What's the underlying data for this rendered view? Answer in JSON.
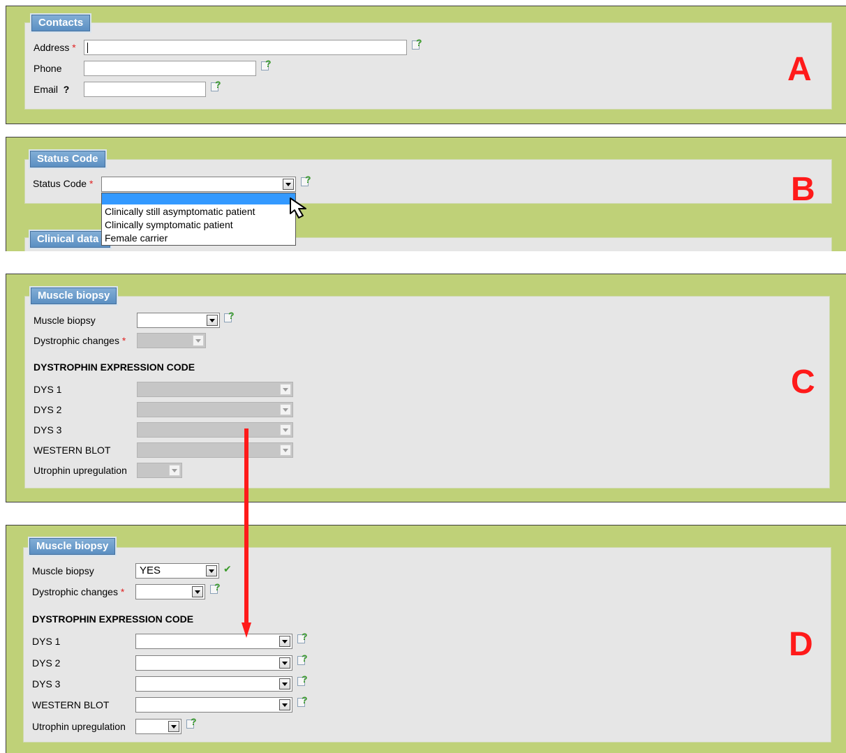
{
  "panel_a": {
    "legend": "Contacts",
    "letter": "A",
    "address_label": "Address",
    "phone_label": "Phone",
    "email_label": "Email",
    "required_mark": "*",
    "question_mark": "?"
  },
  "panel_b": {
    "legend": "Status Code",
    "letter": "B",
    "status_label": "Status Code",
    "required_mark": "*",
    "next_legend": "Clinical data",
    "options": [
      "Clinically still asymptomatic patient",
      "Clinically symptomatic patient",
      "Female carrier"
    ]
  },
  "panel_c": {
    "legend": "Muscle biopsy",
    "letter": "C",
    "muscle_biopsy_label": "Muscle biopsy",
    "dystrophic_label": "Dystrophic changes",
    "required_mark": "*",
    "section_title": "DYSTROPHIN EXPRESSION CODE",
    "dys1_label": "DYS 1",
    "dys2_label": "DYS 2",
    "dys3_label": "DYS 3",
    "western_label": "WESTERN BLOT",
    "utrophin_label": "Utrophin upregulation"
  },
  "panel_d": {
    "legend": "Muscle biopsy",
    "letter": "D",
    "muscle_biopsy_label": "Muscle biopsy",
    "muscle_biopsy_value": "YES",
    "dystrophic_label": "Dystrophic changes",
    "required_mark": "*",
    "section_title": "DYSTROPHIN EXPRESSION CODE",
    "dys1_label": "DYS 1",
    "dys2_label": "DYS 2",
    "dys3_label": "DYS 3",
    "western_label": "WESTERN BLOT",
    "utrophin_label": "Utrophin upregulation",
    "valid_mark": "✔"
  },
  "colors": {
    "frame_green": "#bfd178",
    "panel_gray": "#e6e6e6",
    "legend_blue": "#5b8fc2",
    "annotation_red": "#ff1a1a",
    "dropdown_highlight": "#3399ff"
  }
}
